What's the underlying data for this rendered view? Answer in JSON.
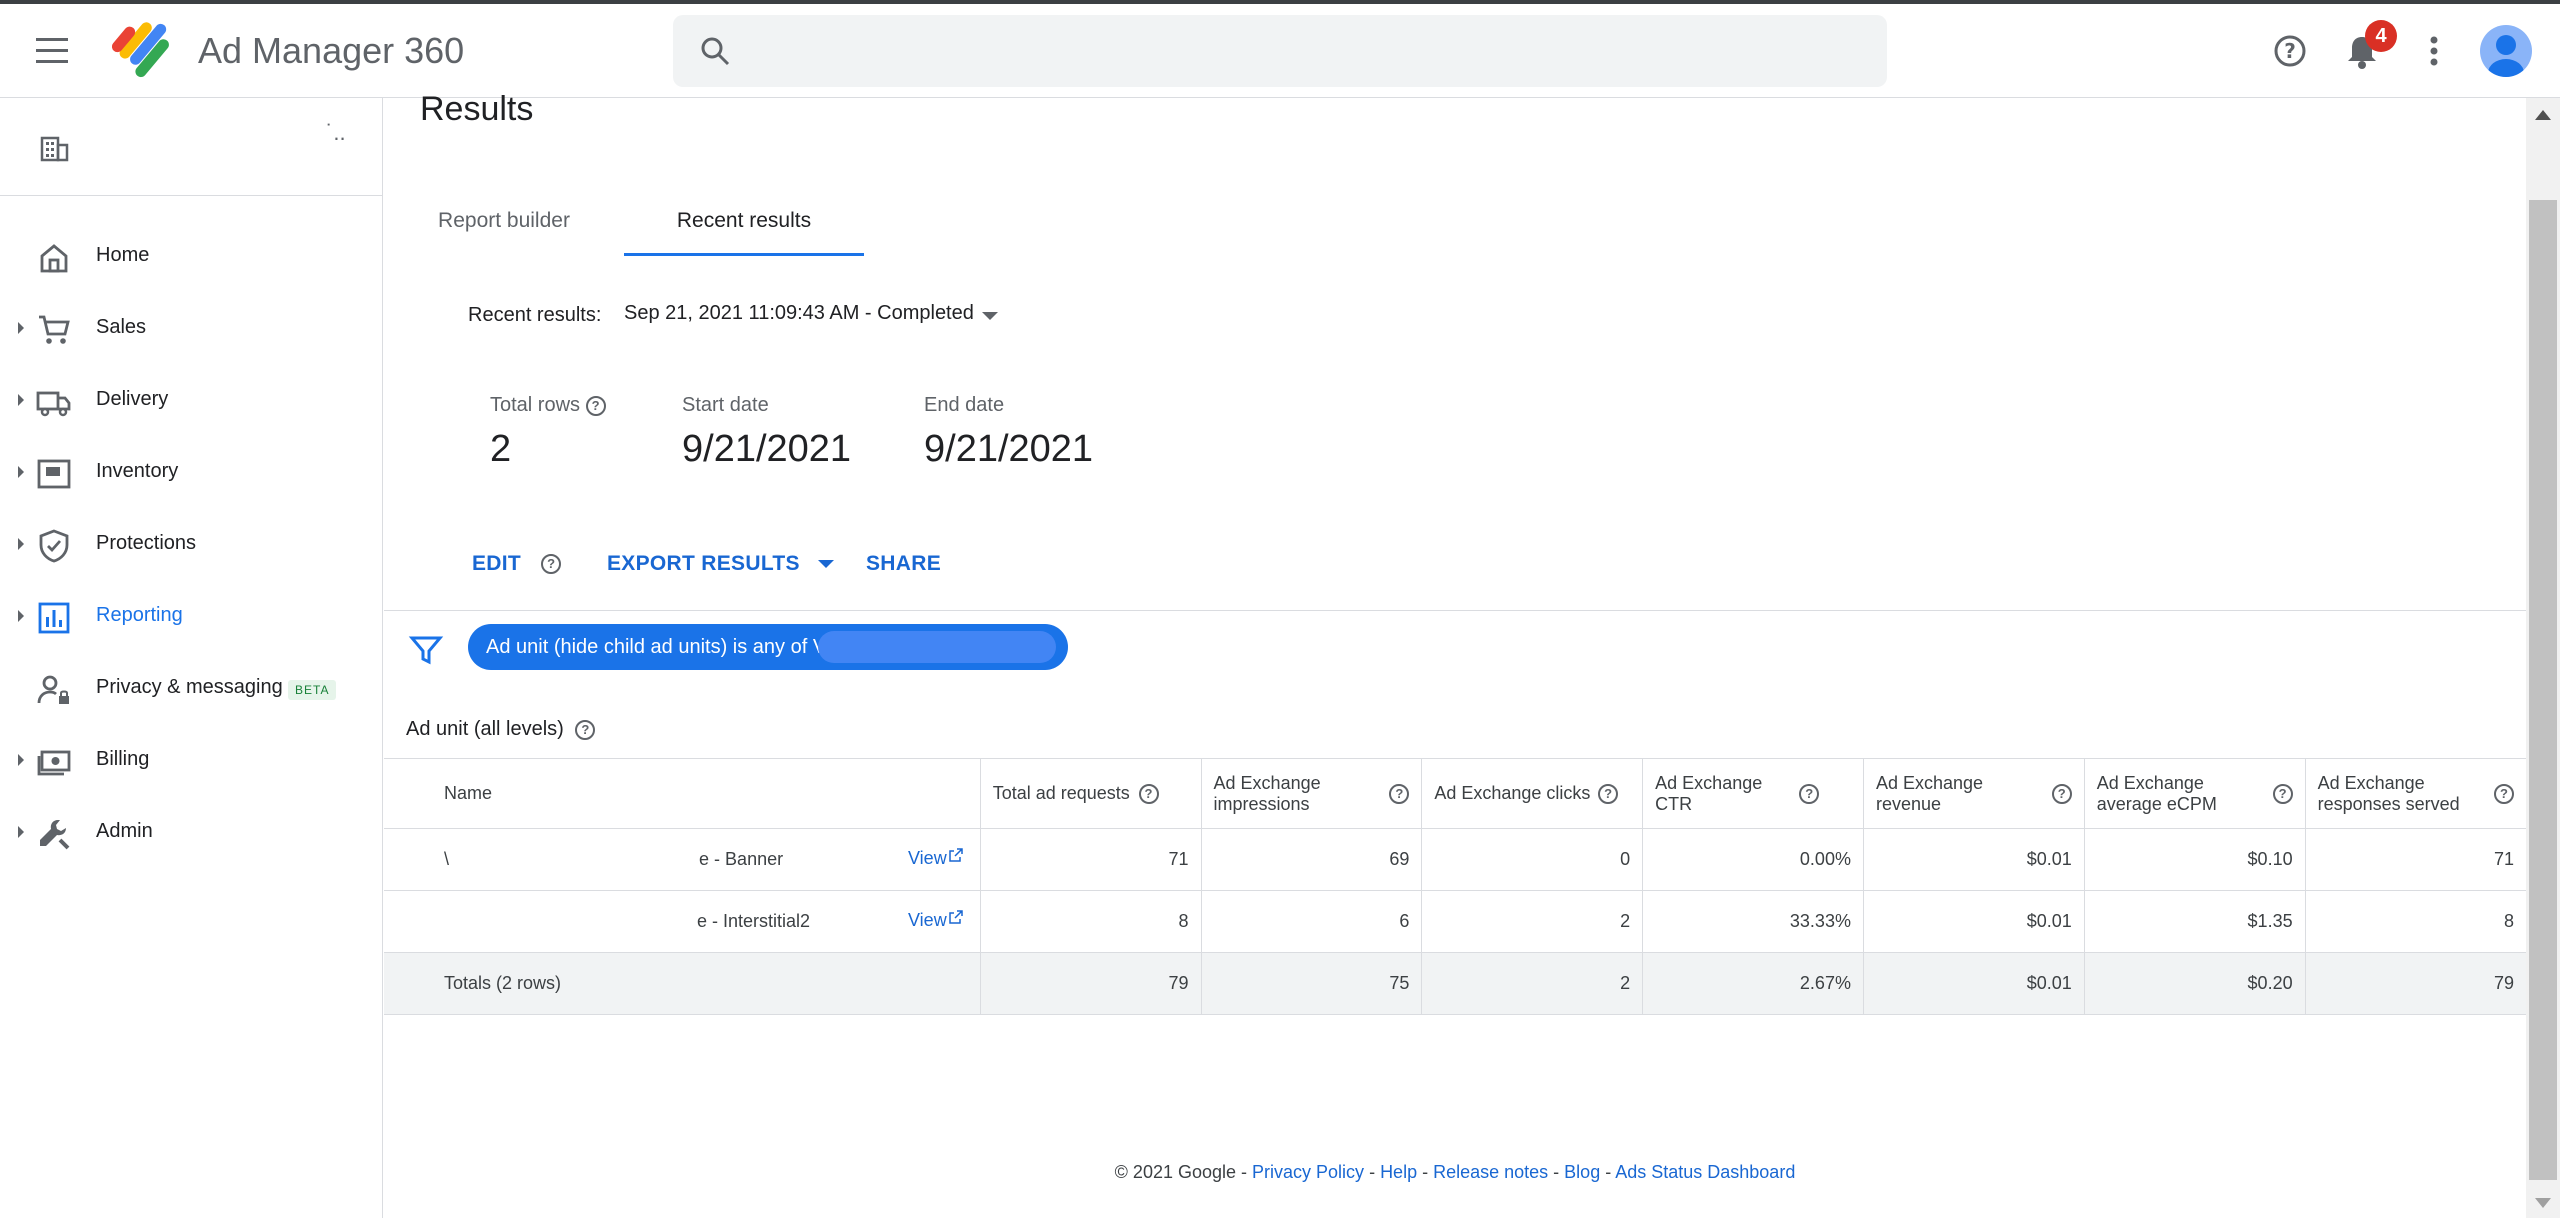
{
  "header": {
    "app_title": "Ad Manager 360",
    "search_placeholder": "",
    "notification_count": "4"
  },
  "sidebar": {
    "items": [
      {
        "label": "Home",
        "icon": "home-icon",
        "caret": false
      },
      {
        "label": "Sales",
        "icon": "cart-icon",
        "caret": true
      },
      {
        "label": "Delivery",
        "icon": "truck-icon",
        "caret": true
      },
      {
        "label": "Inventory",
        "icon": "inventory-icon",
        "caret": true
      },
      {
        "label": "Protections",
        "icon": "shield-icon",
        "caret": true
      },
      {
        "label": "Reporting",
        "icon": "bar-chart-icon",
        "caret": true,
        "active": true
      },
      {
        "label": "Privacy & messaging",
        "icon": "person-lock-icon",
        "caret": false,
        "badge": "BETA"
      },
      {
        "label": "Billing",
        "icon": "billing-icon",
        "caret": true
      },
      {
        "label": "Admin",
        "icon": "wrench-icon",
        "caret": true
      }
    ]
  },
  "main": {
    "page_title": "Results",
    "tabs": [
      {
        "label": "Report builder"
      },
      {
        "label": "Recent results",
        "active": true
      }
    ],
    "recent_results_label": "Recent results:",
    "recent_results_value": "Sep 21, 2021 11:09:43 AM - Completed",
    "stats": {
      "total_rows_label": "Total rows",
      "total_rows_value": "2",
      "start_date_label": "Start date",
      "start_date_value": "9/21/2021",
      "end_date_label": "End date",
      "end_date_value": "9/21/2021"
    },
    "actions": {
      "edit": "EDIT",
      "export": "EXPORT RESULTS",
      "share": "SHARE"
    },
    "filter_chip": "Ad unit (hide child ad units) is any of V",
    "dimension_label": "Ad unit (all levels)",
    "table": {
      "columns": [
        "Name",
        "Total ad requests",
        "Ad Exchange impressions",
        "Ad Exchange clicks",
        "Ad Exchange CTR",
        "Ad Exchange revenue",
        "Ad Exchange average eCPM",
        "Ad Exchange responses served"
      ],
      "rows": [
        {
          "prefix": "\\",
          "name": "e - Banner",
          "view": "View",
          "values": [
            "71",
            "69",
            "0",
            "0.00%",
            "$0.01",
            "$0.10",
            "71"
          ]
        },
        {
          "prefix": "",
          "name": "e - Interstitial2",
          "view": "View",
          "values": [
            "8",
            "6",
            "2",
            "33.33%",
            "$0.01",
            "$1.35",
            "8"
          ]
        }
      ],
      "totals": {
        "label": "Totals (2 rows)",
        "values": [
          "79",
          "75",
          "2",
          "2.67%",
          "$0.01",
          "$0.20",
          "79"
        ]
      }
    }
  },
  "footer": {
    "copyright": "© 2021 Google - ",
    "links": [
      "Privacy Policy",
      "Help",
      "Release notes",
      "Blog",
      "Ads Status Dashboard"
    ]
  },
  "colors": {
    "accent": "#1a73e8",
    "link": "#1967d2",
    "badge": "#d93025"
  }
}
